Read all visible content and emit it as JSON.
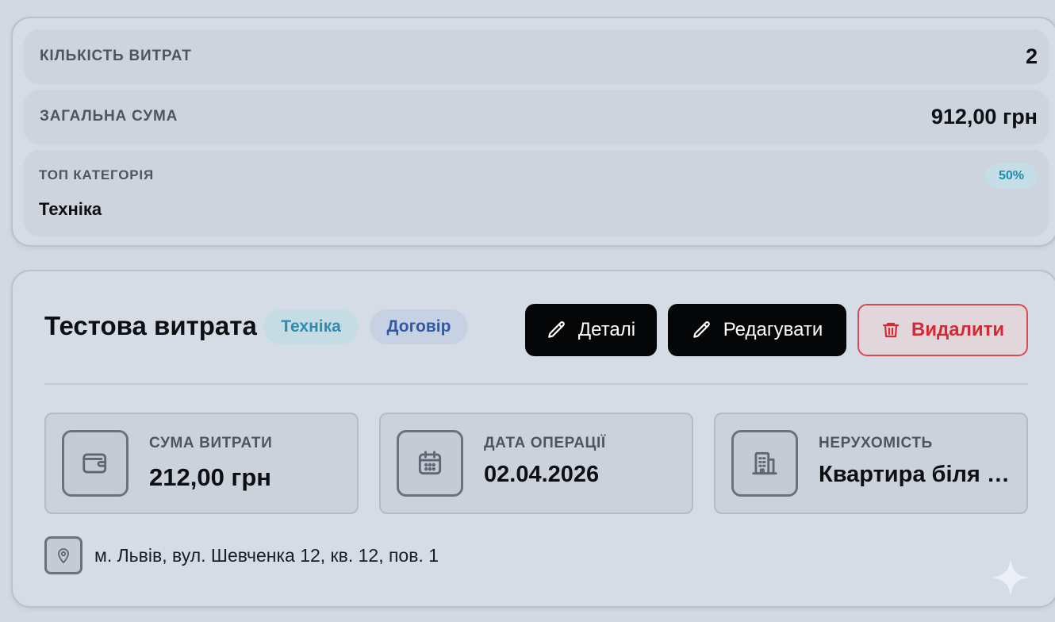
{
  "summary": {
    "count_label": "Кількість витрат",
    "count_value": "2",
    "total_label": "Загальна сума",
    "total_value": "912,00 грн",
    "top_category_label": "Топ категорія",
    "top_category_percent": "50%",
    "top_category_name": "Техніка"
  },
  "expense": {
    "title": "Тестова витрата",
    "category_tag": "Техніка",
    "type_tag": "Договір",
    "buttons": {
      "details": "Деталі",
      "edit": "Редагувати",
      "delete": "Видалити"
    },
    "amount_label": "Сума витрати",
    "amount_value": "212,00 грн",
    "date_label": "Дата операції",
    "date_value": "02.04.2026",
    "property_label": "Нерухомість",
    "property_value": "Квартира біля Б...",
    "address": "м. Львів, вул. Шевченка 12, кв. 12, пов. 1"
  },
  "icons": {
    "details": "pencil-icon",
    "edit": "pencil-icon",
    "delete": "trash-icon",
    "amount": "wallet-icon",
    "date": "calendar-icon",
    "property": "building-icon",
    "address": "map-pin-icon",
    "corner": "sparkle-icon"
  },
  "colors": {
    "page_bg": "#d3d9e2",
    "panel_bg": "#d6dce5",
    "row_bg": "#cdd4de",
    "primary_button": "#050607",
    "danger": "#d42a35",
    "category_tag_text": "#2b8eb0",
    "type_tag_text": "#2f59a8",
    "percent_badge_text": "#1d8cab"
  }
}
